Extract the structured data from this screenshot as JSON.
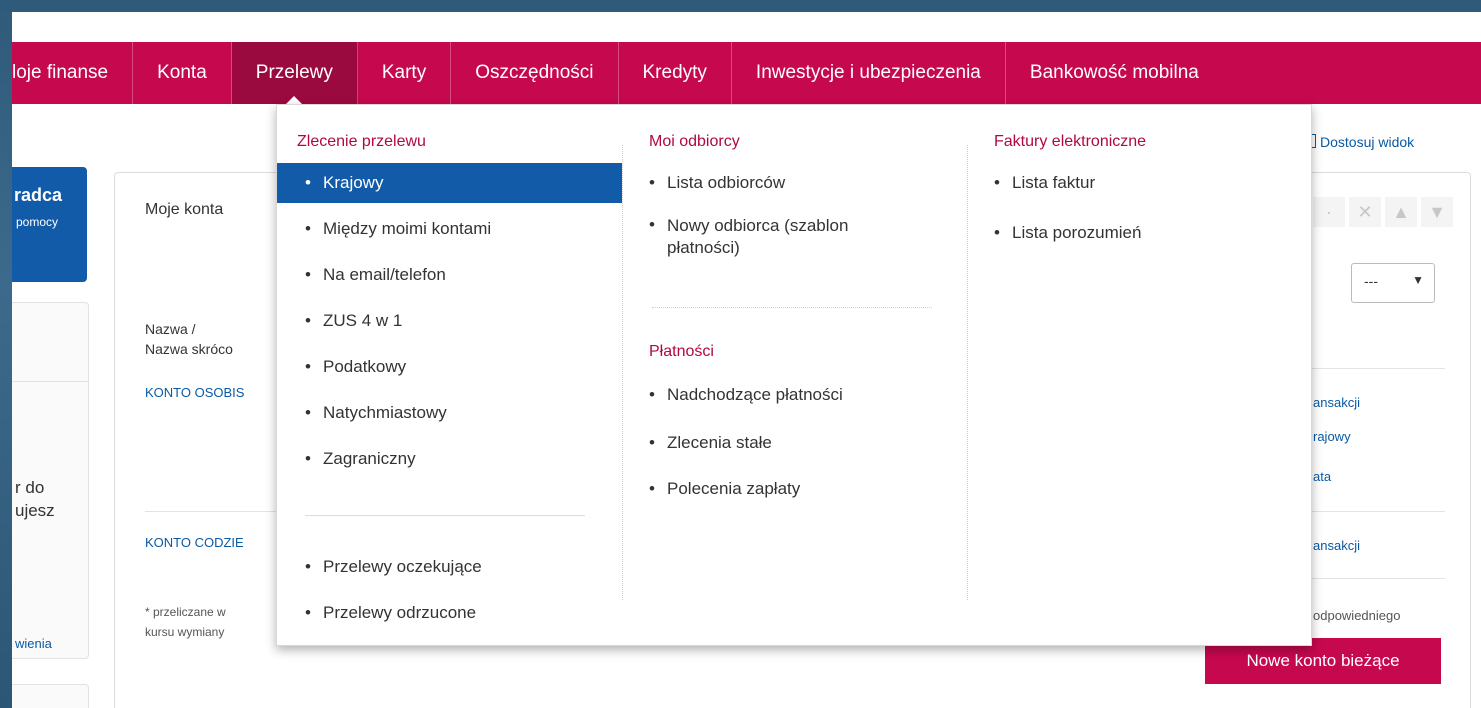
{
  "nav": {
    "items": [
      {
        "label": "loje finanse"
      },
      {
        "label": "Konta"
      },
      {
        "label": "Przelewy"
      },
      {
        "label": "Karty"
      },
      {
        "label": "Oszczędności"
      },
      {
        "label": "Kredyty"
      },
      {
        "label": "Inwestycje i ubezpieczenia"
      },
      {
        "label": "Bankowość mobilna"
      }
    ]
  },
  "dropdown": {
    "col1": {
      "heading": "Zlecenie przelewu",
      "items": [
        {
          "label": "Krajowy"
        },
        {
          "label": "Między moimi kontami"
        },
        {
          "label": "Na email/telefon"
        },
        {
          "label": "ZUS 4 w 1"
        },
        {
          "label": "Podatkowy"
        },
        {
          "label": "Natychmiastowy"
        },
        {
          "label": "Zagraniczny"
        }
      ],
      "items2": [
        {
          "label": "Przelewy oczekujące"
        },
        {
          "label": "Przelewy odrzucone"
        }
      ]
    },
    "col2": {
      "heading": "Moi odbiorcy",
      "items": [
        {
          "label": "Lista odbiorców"
        },
        {
          "label_l1": "Nowy odbiorca (szablon",
          "label_l2": "płatności)"
        }
      ],
      "heading2": "Płatności",
      "items2": [
        {
          "label": "Nadchodzące płatności"
        },
        {
          "label": "Zlecenia stałe"
        },
        {
          "label": "Polecenia zapłaty"
        }
      ]
    },
    "col3": {
      "heading": "Faktury elektroniczne",
      "items": [
        {
          "label": "Lista faktur"
        },
        {
          "label": "Lista porozumień"
        }
      ]
    }
  },
  "page": {
    "dostosuj": "Dostosuj widok",
    "left_widget_t1": "radca",
    "left_widget_t2": "pomocy",
    "left_t1": "r do",
    "left_t2": "ujesz",
    "left_t3": "wienia",
    "tab": "Moje konta",
    "nazwa1": "Nazwa /",
    "nazwa2": "Nazwa skróco",
    "konto1": "KONTO OSOBIS",
    "konto2": "KONTO CODZIE",
    "note1": "* przeliczane w",
    "note2": "kursu wymiany",
    "r_trans1": "ansakcji",
    "r_kraj": "rajowy",
    "r_ata": "ata",
    "r_trans2": "ansakcji",
    "r_odp": "odpowiedniego",
    "select_value": "---",
    "new_account": "Nowe konto bieżące"
  }
}
